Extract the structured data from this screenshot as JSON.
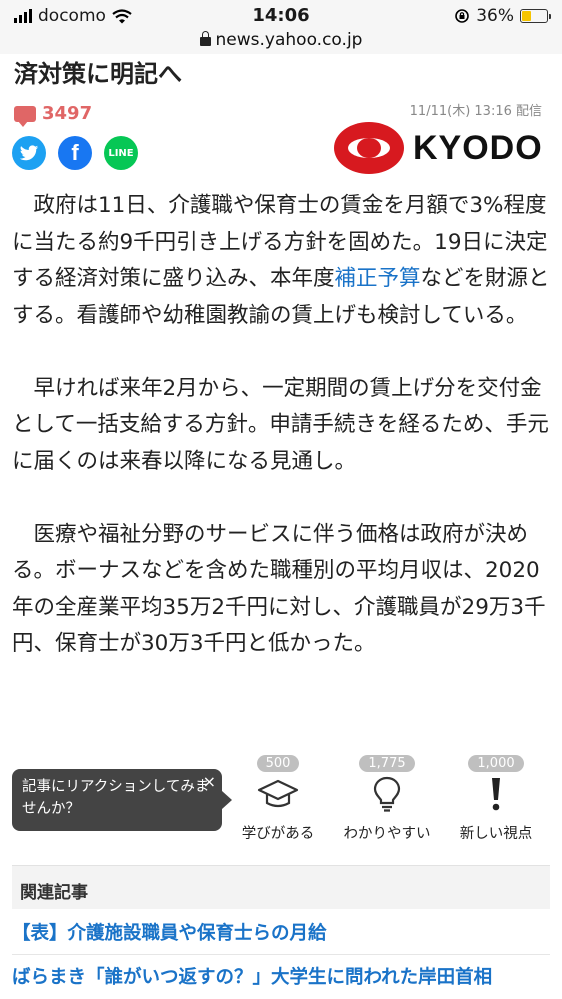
{
  "status_bar": {
    "carrier": "docomo",
    "time": "14:06",
    "battery": "36%",
    "battery_level": 0.36,
    "url": "news.yahoo.co.jp"
  },
  "article": {
    "title_fragment": "済対策に明記へ",
    "comment_count": "3497",
    "date": "11/11(木) 13:16 配信",
    "publisher": "KYODO",
    "share_buttons": [
      {
        "name": "twitter",
        "icon": "twitter-icon"
      },
      {
        "name": "facebook",
        "icon": "facebook-icon",
        "glyph": "f"
      },
      {
        "name": "line",
        "icon": "line-icon",
        "glyph": "LINE"
      }
    ],
    "p1_before": "政府は11日、介護職や保育士の賃金を月額で3%程度に当たる約9千円引き上げる方針を固めた。19日に決定する経済対策に盛り込み、本年度",
    "p1_link": "補正予算",
    "p1_after": "などを財源とする。看護師や幼稚園教諭の賃上げも検討している。",
    "p2": "早ければ来年2月から、一定期間の賃上げ分を交付金として一括支給する方針。申請手続きを経るため、手元に届くのは来春以降になる見通し。",
    "p3": "医療や福祉分野のサービスに伴う価格は政府が決める。ボーナスなどを含めた職種別の平均月収は、2020年の全産業平均35万2千円に対し、介護職員が29万3千円、保育士が30万3千円と低かった。"
  },
  "reaction": {
    "tooltip": "記事にリアクションしてみませんか？",
    "close": "×",
    "items": [
      {
        "count": "500",
        "label": "学びがある",
        "icon": "graduation-cap-icon"
      },
      {
        "count": "1,775",
        "label": "わかりやすい",
        "icon": "lightbulb-icon"
      },
      {
        "count": "1,000",
        "label": "新しい視点",
        "icon": "exclamation-icon"
      }
    ]
  },
  "related": {
    "header": "関連記事",
    "items": [
      "【表】介護施設職員や保育士らの月給",
      "ばらまき「誰がいつ返すの？」大学生に問われた岸田首相"
    ]
  },
  "colors": {
    "link": "#1a73c8",
    "comment": "#e06666",
    "kyodo_red": "#d7191f"
  }
}
